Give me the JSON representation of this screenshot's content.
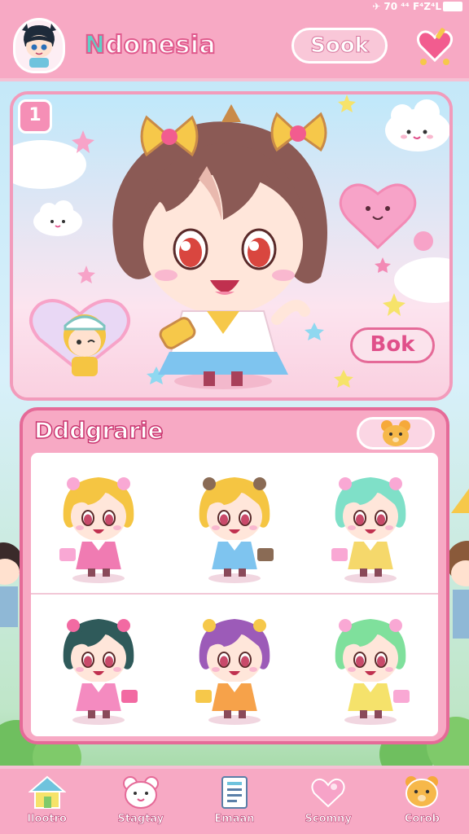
{
  "status_bar": {
    "text": "✈ 70 ⁴⁴ F⁴Z⁴L"
  },
  "header": {
    "title_first": "N",
    "title_rest": "donesia",
    "search_label": "Sook"
  },
  "hero": {
    "corner_label": "1",
    "button_label": "Bok"
  },
  "panel": {
    "title": "Dddgrarie"
  },
  "characters": [
    {
      "hair": "#f5c542",
      "outfit": "#f07bb2",
      "accent": "#f9a8d4"
    },
    {
      "hair": "#f5c542",
      "outfit": "#7ec4ef",
      "accent": "#8a6b55"
    },
    {
      "hair": "#7fe0c8",
      "outfit": "#f5d86b",
      "accent": "#f9a8d4"
    },
    {
      "hair": "#2f5a5a",
      "outfit": "#f48bc0",
      "accent": "#f26aa2"
    },
    {
      "hair": "#9c5bb8",
      "outfit": "#f6a24a",
      "accent": "#f6c84a"
    },
    {
      "hair": "#7fe09c",
      "outfit": "#f5e26b",
      "accent": "#f9a8d4"
    }
  ],
  "nav": [
    {
      "label": "Ilootro",
      "icon": "house-icon"
    },
    {
      "label": "Stagtay",
      "icon": "bear-face-icon"
    },
    {
      "label": "Emaan",
      "icon": "document-icon"
    },
    {
      "label": "Scomny",
      "icon": "heart-bubble-icon"
    },
    {
      "label": "Corob",
      "icon": "bear-icon"
    }
  ],
  "colors": {
    "primary_pink": "#f7a9c4",
    "deep_pink": "#e56a98",
    "sky_blue": "#bfe6f7"
  }
}
